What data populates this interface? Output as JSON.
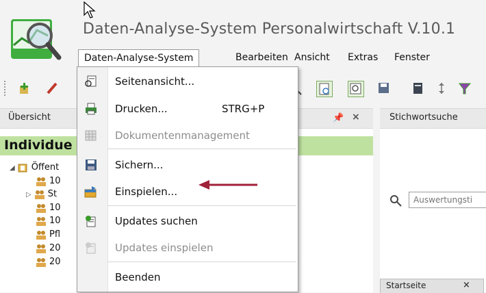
{
  "window": {
    "title": "Daten-Analyse-System Personalwirtschaft V.10.1"
  },
  "menubar": {
    "items": [
      "Daten-Analyse-System",
      "Bearbeiten",
      "Ansicht",
      "Extras",
      "Fenster"
    ]
  },
  "dropdown": {
    "items": [
      {
        "label": "Seitenansicht...",
        "icon": "page-preview-icon",
        "enabled": true
      },
      {
        "label": "Drucken...",
        "shortcut": "STRG+P",
        "icon": "printer-icon",
        "enabled": true
      },
      {
        "label": "Dokumentenmanagement",
        "icon": "grid-icon",
        "enabled": false
      },
      {
        "label": "Sichern...",
        "icon": "save-icon",
        "enabled": true
      },
      {
        "label": "Einspielen...",
        "icon": "import-icon",
        "enabled": true
      },
      {
        "label": "Updates suchen",
        "icon": "updates-search-icon",
        "enabled": true
      },
      {
        "label": "Updates einspielen",
        "icon": "updates-install-icon",
        "enabled": false
      },
      {
        "label": "Beenden",
        "icon": "",
        "enabled": true
      }
    ]
  },
  "left_panel": {
    "title": "Übersicht",
    "heading": "Individue",
    "tree": [
      {
        "label": "Öffent",
        "icon": "folder-icon"
      },
      {
        "label": "10",
        "icon": "group-icon"
      },
      {
        "label": "St",
        "icon": "group-icon"
      },
      {
        "label": "10",
        "icon": "group-icon"
      },
      {
        "label": "10",
        "icon": "group-icon"
      },
      {
        "label": "Pfl",
        "icon": "group-icon"
      },
      {
        "label": "20",
        "icon": "group-icon"
      },
      {
        "label": "20",
        "icon": "group-icon"
      }
    ]
  },
  "right_panel": {
    "title": "Stichwortsuche",
    "search_placeholder": "Auswertungsti",
    "tab_label": "Startseite"
  },
  "colors": {
    "accent_green": "#bfe1a0",
    "arrow": "#a0213a"
  }
}
